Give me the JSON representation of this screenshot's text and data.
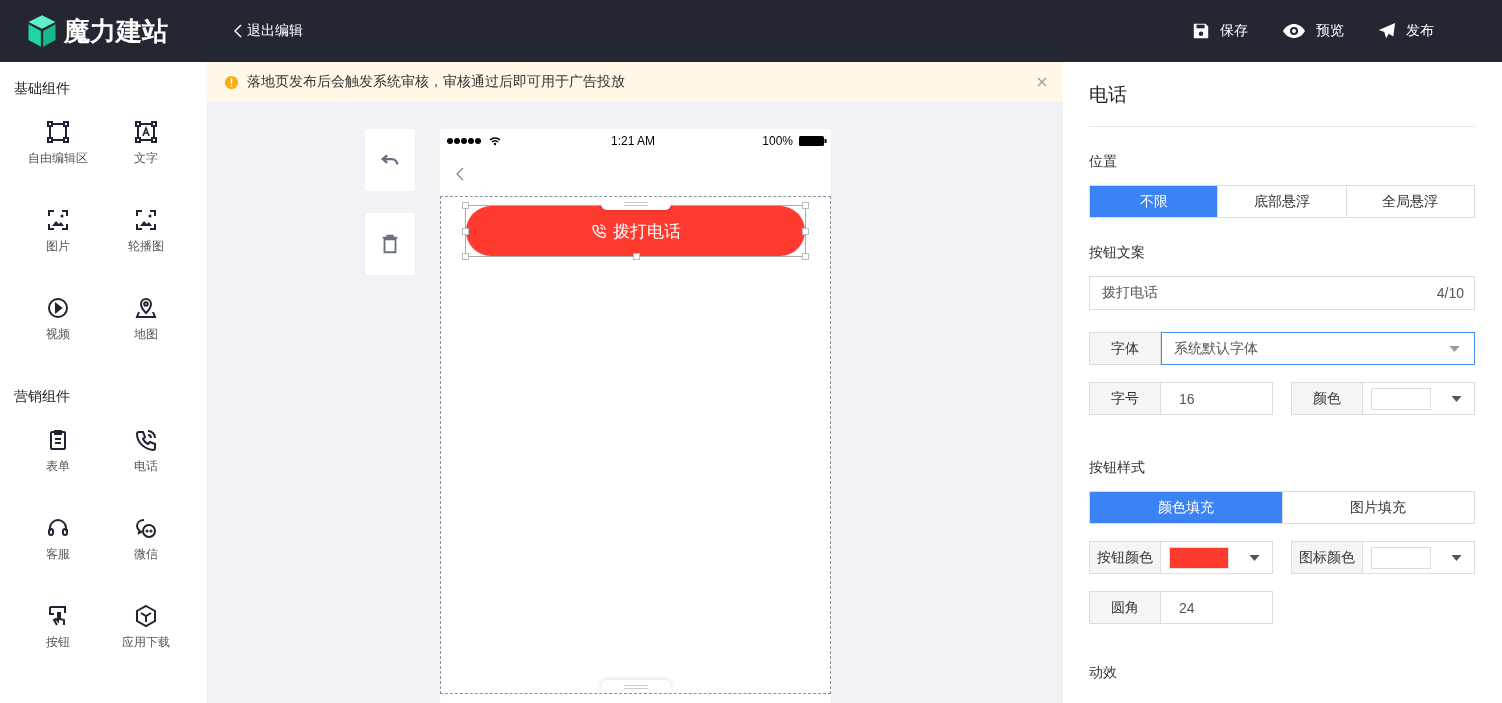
{
  "header": {
    "logo_text": "魔力建站",
    "back_link": "退出编辑",
    "actions": [
      {
        "label": "保存"
      },
      {
        "label": "预览"
      },
      {
        "label": "发布"
      }
    ]
  },
  "sidebar": {
    "groups": [
      {
        "title": "基础组件",
        "items": [
          {
            "label": "自由编辑区"
          },
          {
            "label": "文字"
          },
          {
            "label": "图片"
          },
          {
            "label": "轮播图"
          },
          {
            "label": "视频"
          },
          {
            "label": "地图"
          }
        ]
      },
      {
        "title": "营销组件",
        "items": [
          {
            "label": "表单"
          },
          {
            "label": "电话"
          },
          {
            "label": "客服"
          },
          {
            "label": "微信"
          },
          {
            "label": "按钮"
          },
          {
            "label": "应用下载"
          }
        ]
      }
    ]
  },
  "notice": {
    "text": "落地页发布后会触发系统审核，审核通过后即可用于广告投放"
  },
  "phone": {
    "time": "1:21 AM",
    "battery": "100%",
    "button_label": "拨打电话"
  },
  "panel": {
    "title": "电话",
    "position": {
      "label": "位置",
      "options": [
        {
          "label": "不限",
          "selected": true
        },
        {
          "label": "底部悬浮",
          "selected": false
        },
        {
          "label": "全局悬浮",
          "selected": false
        }
      ]
    },
    "button_text": {
      "label": "按钮文案",
      "value": "拨打电话",
      "counter": "4/10"
    },
    "font": {
      "label": "字体",
      "value": "系统默认字体",
      "focused": true
    },
    "font_size": {
      "label": "字号",
      "value": "16"
    },
    "text_color": {
      "label": "颜色",
      "color": "#ffffff"
    },
    "button_style": {
      "label": "按钮样式",
      "options": [
        {
          "label": "颜色填充",
          "selected": true
        },
        {
          "label": "图片填充",
          "selected": false
        }
      ]
    },
    "button_color": {
      "label": "按钮颜色",
      "color": "#ff3b30"
    },
    "icon_color": {
      "label": "图标颜色",
      "color": "#ffffff"
    },
    "radius": {
      "label": "圆角",
      "value": "24"
    },
    "animation": {
      "label": "动效"
    }
  }
}
